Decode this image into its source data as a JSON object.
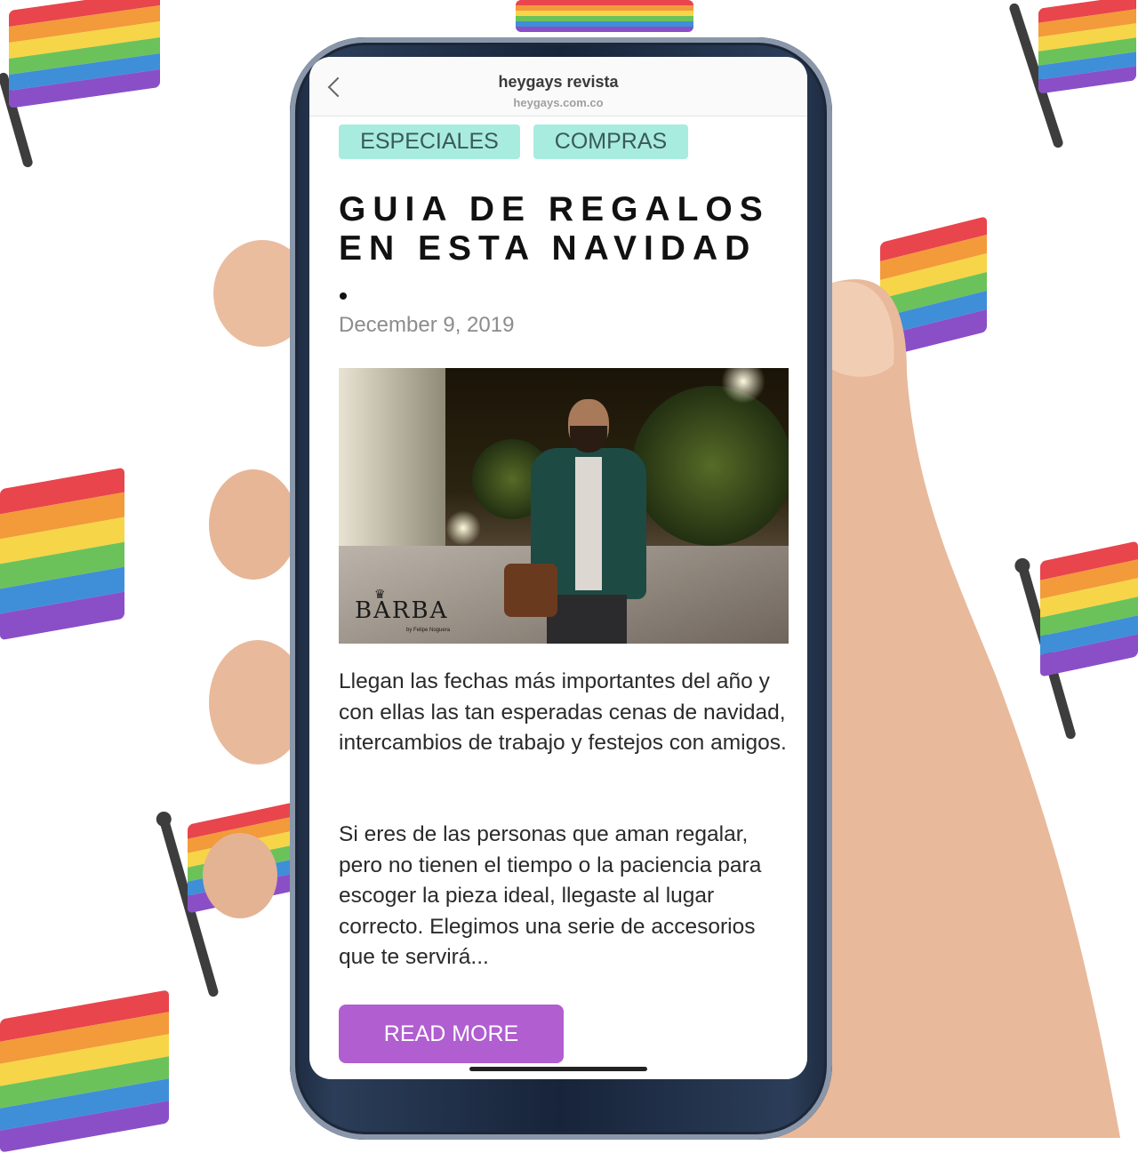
{
  "browser": {
    "site_title": "heygays revista",
    "site_domain": "heygays.com.co",
    "back_icon": "chevron-left-icon"
  },
  "article": {
    "tags": [
      "ESPECIALES",
      "COMPRAS"
    ],
    "headline_line1": "GUIA DE REGALOS",
    "headline_line2": "EN ESTA NAVIDAD",
    "date": "December 9, 2019",
    "image": {
      "logo_text": "BARBA",
      "logo_subtext": "by Felipe Noguera"
    },
    "paragraph1": "Llegan las fechas más importantes del año y con ellas las tan esperadas cenas de navidad, intercambios de trabajo y festejos con amigos.",
    "paragraph2": "Si eres de las personas que aman regalar, pero no tienen el tiempo o la paciencia para escoger la pieza ideal, llegaste al lugar correcto. Elegimos una serie de accesorios que te servirá...",
    "read_more_label": "READ MORE"
  },
  "colors": {
    "tag_bg": "#a8ece0",
    "button_bg": "#b05ed0",
    "rainbow": [
      "#e8454d",
      "#f39a3a",
      "#f7d548",
      "#6cc25a",
      "#3f8ed8",
      "#8a4fc7"
    ]
  }
}
